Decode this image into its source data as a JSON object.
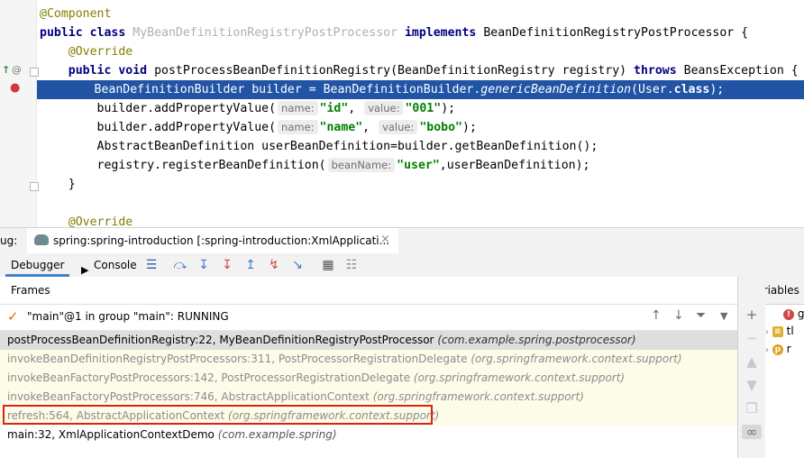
{
  "editor": {
    "lines": {
      "l1_annotation": "@Component",
      "l2_kw1": "public",
      "l2_kw2": "class",
      "l2_classname": "MyBeanDefinitionRegistryPostProcessor",
      "l2_kw3": "implements",
      "l2_iface": "BeanDefinitionRegistryPostProcessor {",
      "l3_annotation": "@Override",
      "l4_kw1": "public",
      "l4_kw2": "void",
      "l4_sig": "postProcessBeanDefinitionRegistry(BeanDefinitionRegistry registry)",
      "l4_kw3": "throws",
      "l4_exc": "BeansException {",
      "l5_part1": "BeanDefinitionBuilder builder = BeanDefinitionBuilder.",
      "l5_method": "genericBeanDefinition",
      "l5_part2": "(User.",
      "l5_kw": "class",
      "l5_part3": ");",
      "l6_call": "builder.addPropertyValue(",
      "l6_hint_name": "name:",
      "l6_arg1": "\"id\"",
      "l6_hint_value": "value:",
      "l6_arg2": "\"001\"",
      "l6_end": ");",
      "l7_call": "builder.addPropertyValue(",
      "l7_hint_name": "name:",
      "l7_arg1": "\"name\"",
      "l7_hint_value": "value:",
      "l7_arg2": "\"bobo\"",
      "l7_end": ");",
      "l8_code": "AbstractBeanDefinition userBeanDefinition=builder.getBeanDefinition();",
      "l9_call": "registry.registerBeanDefinition(",
      "l9_hint": "beanName:",
      "l9_arg": "\"user\"",
      "l9_end": ",userBeanDefinition);",
      "l10_brace": "}",
      "l12_annotation": "@Override"
    },
    "gutter": {
      "override_marker": "↑",
      "annotation_marker": "@",
      "breakpoint_icon": "●"
    }
  },
  "debug_bar": {
    "label": "ug:",
    "session_title": "spring:spring-introduction [:spring-introduction:XmlApplicati...",
    "close": "×"
  },
  "toolbar": {
    "debugger_tab": "Debugger",
    "console_tab": "Console"
  },
  "frames_panel": {
    "title": "Frames",
    "thread": "\"main\"@1 in group \"main\": RUNNING",
    "frames": [
      {
        "method": "postProcessBeanDefinitionRegistry:22, MyBeanDefinitionRegistryPostProcessor",
        "pkg": "(com.example.spring.postprocessor)"
      },
      {
        "method": "invokeBeanDefinitionRegistryPostProcessors:311, PostProcessorRegistrationDelegate",
        "pkg": "(org.springframework.context.support)"
      },
      {
        "method": "invokeBeanFactoryPostProcessors:142, PostProcessorRegistrationDelegate",
        "pkg": "(org.springframework.context.support)"
      },
      {
        "method": "invokeBeanFactoryPostProcessors:746, AbstractApplicationContext",
        "pkg": "(org.springframework.context.support)"
      },
      {
        "method": "refresh:564, AbstractApplicationContext",
        "pkg": "(org.springframework.context.support)"
      },
      {
        "method": "main:32, XmlApplicationContextDemo",
        "pkg": "(com.example.spring)"
      }
    ]
  },
  "variables_panel": {
    "title": "Variables",
    "rows": [
      {
        "icon": "!",
        "text": "g"
      },
      {
        "icon": "≡",
        "text": "tl"
      },
      {
        "icon": "p",
        "text": "r"
      }
    ]
  },
  "colors": {
    "current_line": "#2154a5",
    "keyword": "#000080",
    "string": "#008000",
    "annotation": "#808000",
    "library_frame_bg": "#fcfce9",
    "highlight_box": "#e0210b"
  }
}
